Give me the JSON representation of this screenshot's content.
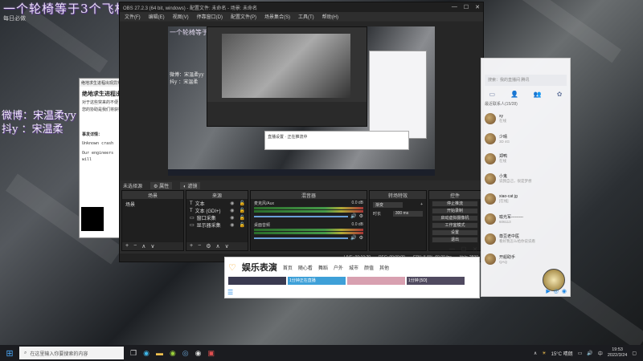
{
  "overlay": {
    "title": "一个轮椅等于3个飞机",
    "weibo": "微博：宋温柔yy",
    "douyin": "抖y ：宋温柔",
    "desk_label": "每日必做"
  },
  "note": {
    "titlebar": "绝地求生进程出现异常",
    "heading": "绝地求生进程出",
    "line1": "对于这些突来的不便",
    "line2": "您的协助是我们将获得",
    "line3": "事发详情：",
    "line4": "Unknown crash",
    "line5": "Our engineers will"
  },
  "obs": {
    "title": "OBS 27.2.3 (64 bit, windows) - 配置文件: 未命名 - 场景: 未命名",
    "menu": [
      "文件(F)",
      "编辑(E)",
      "视图(V)",
      "停靠窗口(D)",
      "配置文件(P)",
      "场景集合(S)",
      "工具(T)",
      "帮助(H)"
    ],
    "no_source": "未选择源",
    "prop_btn": "属性",
    "filter_btn": "滤镜",
    "panels": {
      "scenes": "场景",
      "sources": "来源",
      "mixer": "混音器",
      "transitions": "转场特效",
      "controls": "控件"
    },
    "scene_item": "场景",
    "sources": [
      {
        "icon": "T",
        "label": "文本"
      },
      {
        "icon": "T",
        "label": "文本 (GDI+)"
      },
      {
        "icon": "▭",
        "label": "窗口采集"
      },
      {
        "icon": "▭",
        "label": "显示器采集"
      }
    ],
    "mixer": [
      {
        "name": "麦克风/Aux",
        "db": "0.0 dB"
      },
      {
        "name": "桌面音频",
        "db": "0.0 dB"
      }
    ],
    "transition": {
      "type": "渐变",
      "duration_label": "时长",
      "duration": "300 ms"
    },
    "controls": [
      "停止推流",
      "开始录制",
      "启动虚拟摄像机",
      "工作室模式",
      "设置",
      "退出"
    ],
    "status": {
      "live": "LIVE: 00:10:20",
      "rec": "REC: 00:00:00",
      "cpu": "CPU: 5.5%, 60.00 fps",
      "kbps": "kb/s: 2590"
    },
    "preview_popup": "直播设置 · 正在推流中"
  },
  "qq": {
    "search": "搜索：我的直播间 腾讯",
    "group_title": "最近联系人(15/28)",
    "contacts": [
      {
        "name": "xy",
        "status": "在线"
      },
      {
        "name": "少晴",
        "status": "3D 4G"
      },
      {
        "name": "郑鸭",
        "status": "在线"
      },
      {
        "name": "小鬼",
        "status": "说我自己，很是梦想"
      },
      {
        "name": "xiao-cat jg",
        "status": "[在线]"
      },
      {
        "name": "喻光军---------",
        "status": "606113"
      },
      {
        "name": "尊豆老中医",
        "status": "看好我怎么给你说说看"
      },
      {
        "name": "开船助手",
        "status": "QAQ"
      }
    ],
    "tab_icons": [
      "chat-icon",
      "contacts-icon",
      "group-icon",
      "space-icon"
    ]
  },
  "ent": {
    "logo": "娱乐表演",
    "nav": [
      "首页",
      "随心看",
      "舞蹈",
      "户外",
      "城市",
      "颜值",
      "其他"
    ],
    "thumbs": [
      {
        "label": "",
        "color": "#3a3a50"
      },
      {
        "label": "1分钟正在直播",
        "color": "#3ea0d8"
      },
      {
        "label": "",
        "color": "#d8a0b0"
      },
      {
        "label": "1分钟 [5D]",
        "color": "#504a60"
      }
    ]
  },
  "taskbar": {
    "search_placeholder": "在这里输入你要搜索的内容",
    "weather": "15°C 晴朗",
    "ime": "中",
    "time": "19:53",
    "date": "2022/3/24"
  }
}
